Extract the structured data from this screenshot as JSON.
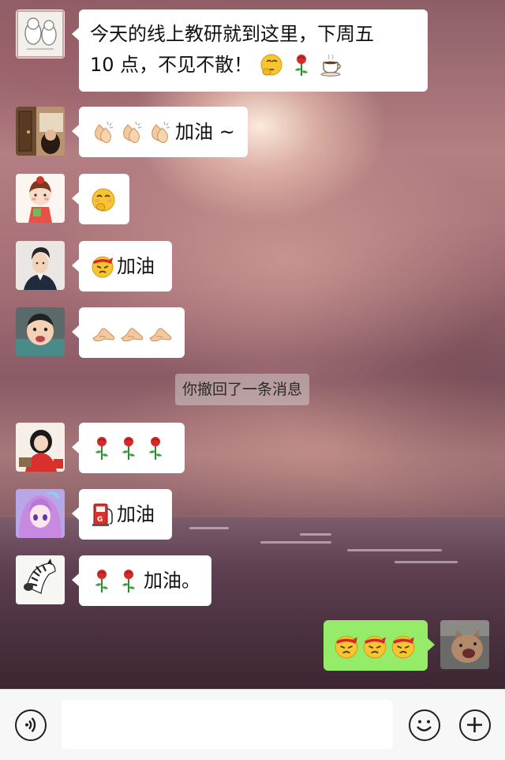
{
  "chat": {
    "messages": [
      {
        "sender": "other",
        "avatar": "avatar-cartoon-sketch",
        "text_line1": "今天的线上教研就到这里，下周五",
        "text_line2": "10 点，不见不散！",
        "emoji": [
          "thinking-face-emoji",
          "rose-emoji",
          "coffee-emoji"
        ]
      },
      {
        "sender": "other",
        "avatar": "avatar-photo-door",
        "text": "加油 ~",
        "emoji": [
          "clapping-hands-emoji",
          "clapping-hands-emoji",
          "clapping-hands-emoji"
        ]
      },
      {
        "sender": "other",
        "avatar": "avatar-cartoon-girl",
        "emoji": [
          "grinning-covering-mouth-emoji"
        ]
      },
      {
        "sender": "other",
        "avatar": "avatar-man-suit",
        "text": "加油",
        "emoji": [
          "determined-face-emoji"
        ]
      },
      {
        "sender": "other",
        "avatar": "avatar-baby",
        "emoji": [
          "pointing-hand-emoji",
          "pointing-hand-emoji",
          "pointing-hand-emoji"
        ]
      },
      {
        "sender": "system",
        "text": "你撤回了一条消息"
      },
      {
        "sender": "other",
        "avatar": "avatar-red-girl",
        "emoji": [
          "rose-emoji",
          "rose-emoji",
          "rose-emoji"
        ]
      },
      {
        "sender": "other",
        "avatar": "avatar-anime-purple",
        "text": "加油",
        "emoji": [
          "fuel-pump-emoji"
        ]
      },
      {
        "sender": "other",
        "avatar": "avatar-zebra",
        "text": "加油。",
        "emoji": [
          "rose-emoji",
          "rose-emoji"
        ]
      },
      {
        "sender": "me",
        "avatar": "avatar-cat",
        "emoji": [
          "determined-face-emoji",
          "determined-face-emoji",
          "determined-face-emoji"
        ]
      }
    ]
  },
  "input_bar": {
    "text_value": "",
    "voice_icon": "voice-icon",
    "emoji_icon": "emoji-icon",
    "plus_icon": "plus-icon"
  },
  "colors": {
    "bubble_other": "#ffffff",
    "bubble_me": "#95ec69",
    "input_bar_bg": "#f7f7f7"
  }
}
